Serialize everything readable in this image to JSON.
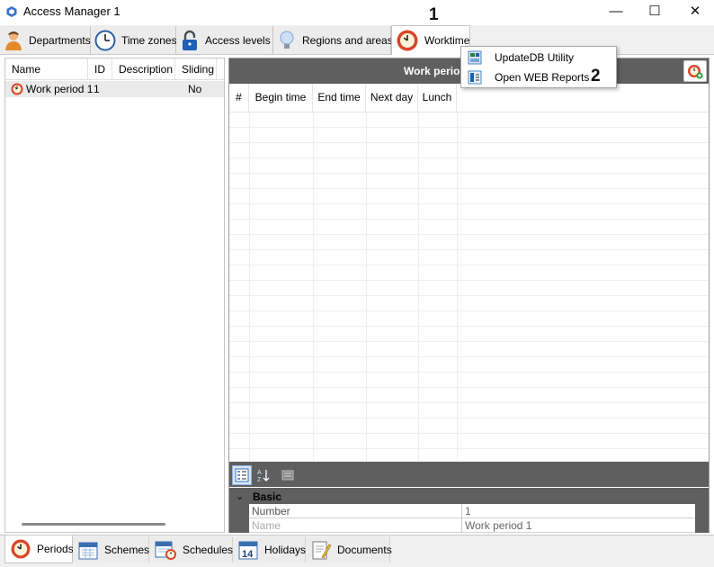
{
  "window": {
    "title": "Access Manager 1",
    "controls": {
      "minimize": "—",
      "maximize": "☐",
      "close": "✕"
    }
  },
  "top_tabs": [
    {
      "label": "Departments",
      "icon": "person-icon"
    },
    {
      "label": "Time zones",
      "icon": "clock-icon"
    },
    {
      "label": "Access levels",
      "icon": "padlock-icon"
    },
    {
      "label": "Regions and areas",
      "icon": "lightbulb-icon"
    },
    {
      "label": "Worktime",
      "icon": "worktime-clock-icon",
      "active": true
    }
  ],
  "annotations": {
    "step1": "1",
    "step2": "2"
  },
  "dropdown_menu": {
    "items": [
      {
        "label": "UpdateDB Utility",
        "icon": "database-utility-icon"
      },
      {
        "label": "Open WEB Reports",
        "icon": "web-reports-icon"
      }
    ]
  },
  "left_grid": {
    "columns": [
      "Name",
      "ID",
      "Description",
      "Sliding"
    ],
    "rows": [
      {
        "name": "Work period 1",
        "id": "1",
        "description": "",
        "sliding": "No"
      }
    ]
  },
  "right_panel": {
    "title": "Work period",
    "columns": [
      "#",
      "Begin time",
      "End time",
      "Next day",
      "Lunch"
    ]
  },
  "property_grid": {
    "category": "Basic",
    "rows": [
      {
        "name": "Number",
        "value": "1"
      },
      {
        "name": "Name",
        "value": "Work period 1"
      }
    ]
  },
  "bottom_tabs": [
    {
      "label": "Periods",
      "icon": "worktime-clock-icon",
      "active": true
    },
    {
      "label": "Schemes",
      "icon": "calendar-icon"
    },
    {
      "label": "Schedules",
      "icon": "calendar-clock-icon"
    },
    {
      "label": "Holidays",
      "icon": "calendar-14-icon"
    },
    {
      "label": "Documents",
      "icon": "document-pencil-icon"
    }
  ],
  "colors": {
    "panel_header": "#5f5f5f",
    "accent_red": "#d9442a",
    "selected_row": "#eaeaea"
  }
}
